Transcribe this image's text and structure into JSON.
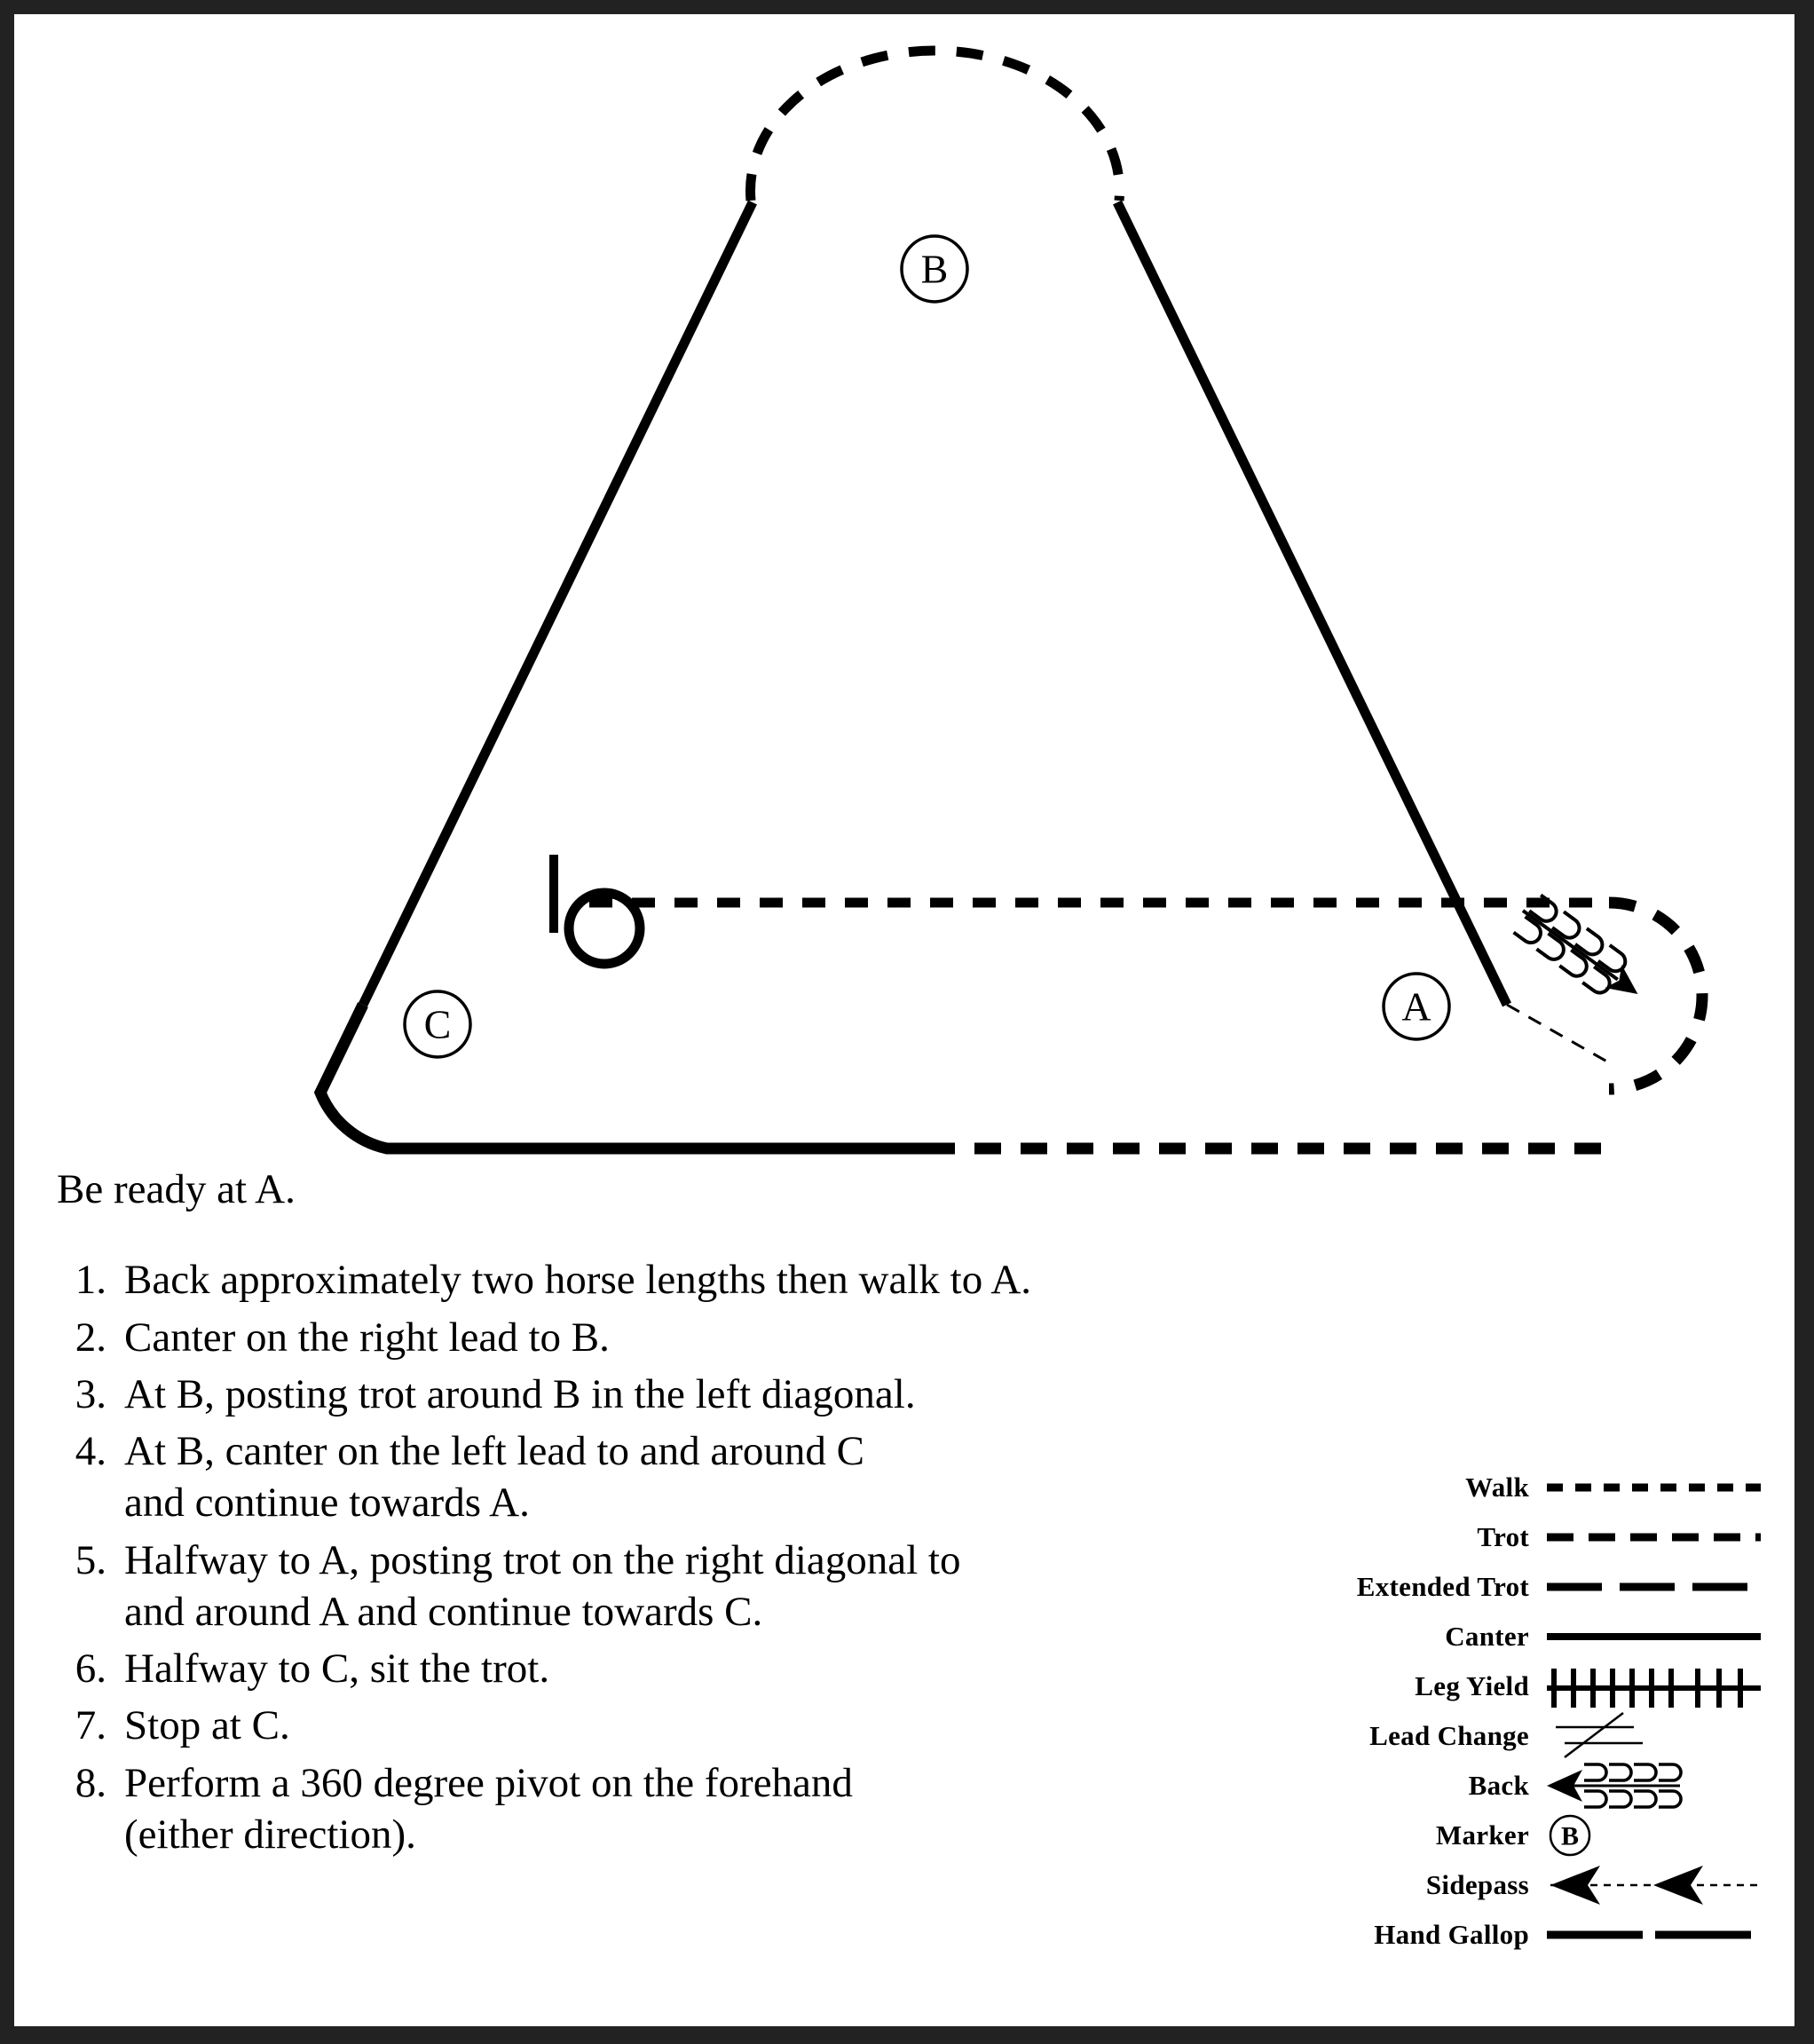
{
  "document": {
    "type": "horsemanship-pattern-diagram",
    "intro": "Be ready at A.",
    "markers": [
      "A",
      "B",
      "C"
    ]
  },
  "diagram": {
    "marker_a": "A",
    "marker_b": "B",
    "marker_c": "C",
    "elements": [
      {
        "name": "trot-arc-around-b",
        "gait": "Trot",
        "style": "dashed"
      },
      {
        "name": "canter-line-b-to-c",
        "gait": "Canter",
        "style": "solid"
      },
      {
        "name": "canter-line-b-to-a",
        "gait": "Canter",
        "style": "solid"
      },
      {
        "name": "walk-line-middle",
        "gait": "Walk",
        "style": "dashed"
      },
      {
        "name": "walk-arc-around-a",
        "gait": "Walk",
        "style": "dashed"
      },
      {
        "name": "back-symbol-at-a",
        "gait": "Back",
        "style": "arrow-with-hoofprints"
      },
      {
        "name": "canter-turn-around-c",
        "gait": "Canter",
        "style": "solid"
      },
      {
        "name": "stop-bar-near-c",
        "gait": "Stop",
        "style": "vertical-bar"
      },
      {
        "name": "pivot-circle-near-c",
        "gait": "Pivot 360",
        "style": "circle"
      },
      {
        "name": "bottom-canter-then-walk",
        "gait": "Canter / Walk",
        "style": "solid-then-dashed"
      }
    ]
  },
  "instructions": {
    "intro": "Be ready at A.",
    "steps": [
      {
        "number": "1.",
        "lines": [
          "Back approximately two horse lengths then walk to A."
        ]
      },
      {
        "number": "2.",
        "lines": [
          "Canter on the right lead to B."
        ]
      },
      {
        "number": "3.",
        "lines": [
          "At B, posting trot around B in the left diagonal."
        ]
      },
      {
        "number": "4.",
        "lines": [
          "At B, canter on the left lead to and around C",
          "and continue towards A."
        ]
      },
      {
        "number": "5.",
        "lines": [
          "Halfway to A, posting trot on the right diagonal to",
          "and around A and continue towards C."
        ]
      },
      {
        "number": "6.",
        "lines": [
          "Halfway to C, sit the trot."
        ]
      },
      {
        "number": "7.",
        "lines": [
          "Stop at C."
        ]
      },
      {
        "number": "8.",
        "lines": [
          "Perform a 360 degree pivot on the forehand",
          "(either direction)."
        ]
      }
    ]
  },
  "legend": {
    "rows": [
      {
        "label": "Walk",
        "symbol": "walk-dashed-line"
      },
      {
        "label": "Trot",
        "symbol": "trot-dashed-line"
      },
      {
        "label": "Extended Trot",
        "symbol": "extended-trot-dashed-line"
      },
      {
        "label": "Canter",
        "symbol": "canter-solid-line"
      },
      {
        "label": "Leg Yield",
        "symbol": "leg-yield-hatched-line"
      },
      {
        "label": "Lead Change",
        "symbol": "lead-change-slash"
      },
      {
        "label": "Back",
        "symbol": "back-arrow-hoofprints"
      },
      {
        "label": "Marker",
        "symbol": "marker-circle-b"
      },
      {
        "label": "Sidepass",
        "symbol": "sidepass-double-arrow"
      },
      {
        "label": "Hand Gallop",
        "symbol": "hand-gallop-long-dash"
      }
    ],
    "marker_symbol_letter": "B"
  },
  "colors": {
    "ink": "#000000",
    "page": "#ffffff",
    "frame": "#222222"
  }
}
